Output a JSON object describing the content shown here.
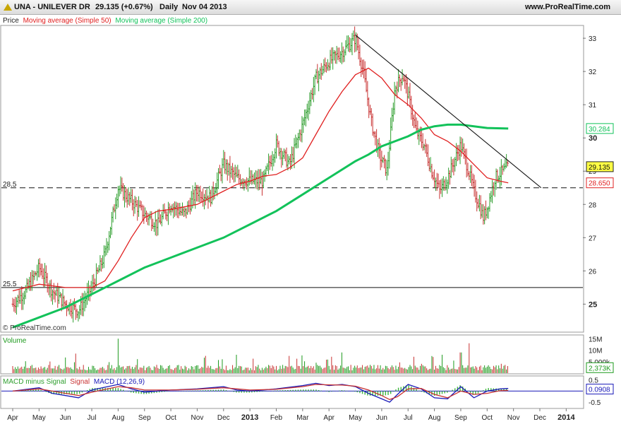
{
  "header": {
    "symbol": "UNA - UNILEVER DR",
    "price": "29.135 (+0.67%)",
    "period": "Daily",
    "date": "Nov 04 2013",
    "site": "www.ProRealTime.com"
  },
  "watermark": "© ProRealTime.com",
  "legend": {
    "price": "Price",
    "ma50": "Moving average (Simple 50)",
    "ma200": "Moving average (Simple 200)"
  },
  "colors": {
    "up": "#2e9e2e",
    "down": "#c83232",
    "ma50": "#e02020",
    "ma200": "#12c25a",
    "volume": "#1e9a1e",
    "macd": "#1a1ab8",
    "signal": "#c83232",
    "hist": "#3cb43c"
  },
  "chart_data": [
    {
      "type": "line",
      "panel": "price",
      "x_ticks": [
        "Apr",
        "May",
        "Jun",
        "Jul",
        "Aug",
        "Sep",
        "Oct",
        "Nov",
        "Dec",
        "2013",
        "Feb",
        "Mar",
        "Apr",
        "May",
        "Jun",
        "Jul",
        "Aug",
        "Sep",
        "Oct",
        "Nov",
        "Dec",
        "2014"
      ],
      "y_ticks": [
        "25",
        "26",
        "27",
        "28",
        "29",
        "30",
        "31",
        "32",
        "33"
      ],
      "ylim": [
        24.2,
        33.3
      ],
      "levels": [
        {
          "label": "28.5",
          "value": 28.5,
          "style": "dashed"
        },
        {
          "label": "25.5",
          "value": 25.5,
          "style": "solid"
        }
      ],
      "trendline": [
        [
          13.0,
          33.1
        ],
        [
          20.05,
          28.5
        ]
      ],
      "price": [
        [
          0,
          25.0
        ],
        [
          0.5,
          25.4
        ],
        [
          1.0,
          26.1
        ],
        [
          1.5,
          25.4
        ],
        [
          2.0,
          25.0
        ],
        [
          2.5,
          24.8
        ],
        [
          3.0,
          25.5
        ],
        [
          3.5,
          26.5
        ],
        [
          4.0,
          28.5
        ],
        [
          4.5,
          28.1
        ],
        [
          5.0,
          27.7
        ],
        [
          5.5,
          27.4
        ],
        [
          6.0,
          28.0
        ],
        [
          6.5,
          27.7
        ],
        [
          7.0,
          28.4
        ],
        [
          7.5,
          28.2
        ],
        [
          8.0,
          29.2
        ],
        [
          8.5,
          28.8
        ],
        [
          9.0,
          28.7
        ],
        [
          9.5,
          28.7
        ],
        [
          10.0,
          29.8
        ],
        [
          10.5,
          29.2
        ],
        [
          11.0,
          30.4
        ],
        [
          11.5,
          31.8
        ],
        [
          12.0,
          32.3
        ],
        [
          12.5,
          32.6
        ],
        [
          13.0,
          33.0
        ],
        [
          13.3,
          32.0
        ],
        [
          13.6,
          30.5
        ],
        [
          13.9,
          29.5
        ],
        [
          14.2,
          29.0
        ],
        [
          14.5,
          31.5
        ],
        [
          14.8,
          31.9
        ],
        [
          15.0,
          31.3
        ],
        [
          15.3,
          30.2
        ],
        [
          15.6,
          29.8
        ],
        [
          15.9,
          29.0
        ],
        [
          16.2,
          28.4
        ],
        [
          16.5,
          28.8
        ],
        [
          16.8,
          29.4
        ],
        [
          17.0,
          29.8
        ],
        [
          17.3,
          29.0
        ],
        [
          17.5,
          28.4
        ],
        [
          17.7,
          28.0
        ],
        [
          17.85,
          27.6
        ],
        [
          18.0,
          27.9
        ],
        [
          18.3,
          28.8
        ],
        [
          18.6,
          29.0
        ],
        [
          18.8,
          29.135
        ]
      ],
      "series": [
        {
          "name": "Moving average (Simple 50)",
          "points": [
            [
              0,
              25.4
            ],
            [
              1.0,
              25.6
            ],
            [
              2.0,
              25.5
            ],
            [
              3.0,
              25.5
            ],
            [
              3.5,
              25.7
            ],
            [
              4.0,
              26.3
            ],
            [
              4.5,
              27.0
            ],
            [
              5.0,
              27.6
            ],
            [
              5.5,
              27.8
            ],
            [
              6.0,
              27.85
            ],
            [
              7.0,
              28.0
            ],
            [
              8.0,
              28.4
            ],
            [
              8.5,
              28.6
            ],
            [
              9.0,
              28.7
            ],
            [
              9.5,
              28.85
            ],
            [
              10.0,
              28.9
            ],
            [
              10.5,
              29.1
            ],
            [
              11.0,
              29.4
            ],
            [
              11.5,
              30.1
            ],
            [
              12.0,
              30.8
            ],
            [
              12.5,
              31.4
            ],
            [
              13.0,
              31.9
            ],
            [
              13.5,
              32.1
            ],
            [
              14.0,
              31.8
            ],
            [
              14.5,
              31.3
            ],
            [
              15.0,
              31.0
            ],
            [
              15.5,
              30.6
            ],
            [
              16.0,
              30.1
            ],
            [
              16.5,
              29.9
            ],
            [
              17.0,
              29.6
            ],
            [
              17.5,
              29.2
            ],
            [
              18.0,
              28.8
            ],
            [
              18.5,
              28.7
            ],
            [
              18.8,
              28.65
            ]
          ]
        },
        {
          "name": "Moving average (Simple 200)",
          "points": [
            [
              0,
              24.3
            ],
            [
              1.0,
              24.6
            ],
            [
              2.0,
              24.9
            ],
            [
              3.0,
              25.3
            ],
            [
              4.0,
              25.7
            ],
            [
              5.0,
              26.1
            ],
            [
              6.0,
              26.4
            ],
            [
              7.0,
              26.7
            ],
            [
              8.0,
              27.0
            ],
            [
              9.0,
              27.4
            ],
            [
              10.0,
              27.8
            ],
            [
              11.0,
              28.3
            ],
            [
              12.0,
              28.8
            ],
            [
              13.0,
              29.3
            ],
            [
              13.5,
              29.5
            ],
            [
              14.0,
              29.75
            ],
            [
              15.0,
              30.05
            ],
            [
              15.5,
              30.25
            ],
            [
              16.0,
              30.35
            ],
            [
              16.5,
              30.4
            ],
            [
              17.0,
              30.4
            ],
            [
              17.5,
              30.35
            ],
            [
              18.0,
              30.3
            ],
            [
              18.8,
              30.284
            ]
          ]
        }
      ],
      "value_labels": [
        {
          "label": "30.284",
          "value": 30.284,
          "series": "Moving average (Simple 200)"
        },
        {
          "label": "29.135",
          "value": 29.135,
          "series": "Price"
        },
        {
          "label": "28.650",
          "value": 28.65,
          "series": "Moving average (Simple 50)"
        }
      ]
    },
    {
      "type": "bar",
      "panel": "volume",
      "title": "Volume",
      "y_ticks": [
        "15M",
        "10M",
        "5.000k"
      ],
      "ylim": [
        0,
        16
      ],
      "last_value_label": "2,373K",
      "spikes": [
        [
          4.0,
          15.0
        ],
        [
          2.4,
          8.5
        ],
        [
          17.3,
          13.0
        ],
        [
          17.0,
          9.0
        ],
        [
          10.5,
          7.5
        ],
        [
          8.5,
          8.0
        ],
        [
          12.5,
          9.0
        ],
        [
          16.3,
          8.0
        ]
      ]
    },
    {
      "type": "line",
      "panel": "macd",
      "title": "MACD minus Signal",
      "title_signal": "Signal",
      "title_macd": "MACD (12,26,9)",
      "y_ticks": [
        "0.5",
        "-0.5"
      ],
      "ylim": [
        -0.75,
        0.65
      ],
      "last_value_label": "0.0908",
      "series": [
        {
          "name": "MACD (12,26,9)",
          "points": [
            [
              0,
              0.0
            ],
            [
              1.0,
              0.15
            ],
            [
              1.5,
              -0.1
            ],
            [
              2.0,
              -0.2
            ],
            [
              2.5,
              -0.3
            ],
            [
              3.0,
              0.05
            ],
            [
              4.0,
              0.3
            ],
            [
              4.5,
              0.1
            ],
            [
              5.0,
              -0.05
            ],
            [
              6.0,
              0.05
            ],
            [
              7.0,
              0.1
            ],
            [
              8.0,
              0.2
            ],
            [
              8.5,
              0.05
            ],
            [
              9.0,
              0.0
            ],
            [
              10.0,
              0.1
            ],
            [
              11.0,
              0.25
            ],
            [
              11.5,
              0.35
            ],
            [
              12.0,
              0.25
            ],
            [
              12.5,
              0.3
            ],
            [
              13.0,
              0.2
            ],
            [
              13.5,
              -0.1
            ],
            [
              14.0,
              -0.35
            ],
            [
              14.3,
              -0.5
            ],
            [
              14.6,
              -0.15
            ],
            [
              15.0,
              0.3
            ],
            [
              15.5,
              0.1
            ],
            [
              16.0,
              -0.3
            ],
            [
              16.5,
              -0.35
            ],
            [
              17.0,
              0.2
            ],
            [
              17.5,
              -0.3
            ],
            [
              18.0,
              0.0
            ],
            [
              18.5,
              0.1
            ],
            [
              18.8,
              0.12
            ]
          ]
        },
        {
          "name": "Signal",
          "points": [
            [
              0,
              0.0
            ],
            [
              1.0,
              0.1
            ],
            [
              1.5,
              0.0
            ],
            [
              2.0,
              -0.1
            ],
            [
              2.5,
              -0.2
            ],
            [
              3.0,
              -0.05
            ],
            [
              4.0,
              0.2
            ],
            [
              4.5,
              0.15
            ],
            [
              5.0,
              0.05
            ],
            [
              6.0,
              0.05
            ],
            [
              7.0,
              0.08
            ],
            [
              8.0,
              0.15
            ],
            [
              8.5,
              0.1
            ],
            [
              9.0,
              0.05
            ],
            [
              10.0,
              0.08
            ],
            [
              11.0,
              0.2
            ],
            [
              11.5,
              0.3
            ],
            [
              12.0,
              0.28
            ],
            [
              12.5,
              0.27
            ],
            [
              13.0,
              0.22
            ],
            [
              13.5,
              0.05
            ],
            [
              14.0,
              -0.2
            ],
            [
              14.3,
              -0.38
            ],
            [
              14.6,
              -0.25
            ],
            [
              15.0,
              0.1
            ],
            [
              15.5,
              0.12
            ],
            [
              16.0,
              -0.15
            ],
            [
              16.5,
              -0.3
            ],
            [
              17.0,
              0.0
            ],
            [
              17.5,
              -0.15
            ],
            [
              18.0,
              -0.1
            ],
            [
              18.5,
              0.02
            ],
            [
              18.8,
              0.03
            ]
          ]
        }
      ]
    }
  ]
}
